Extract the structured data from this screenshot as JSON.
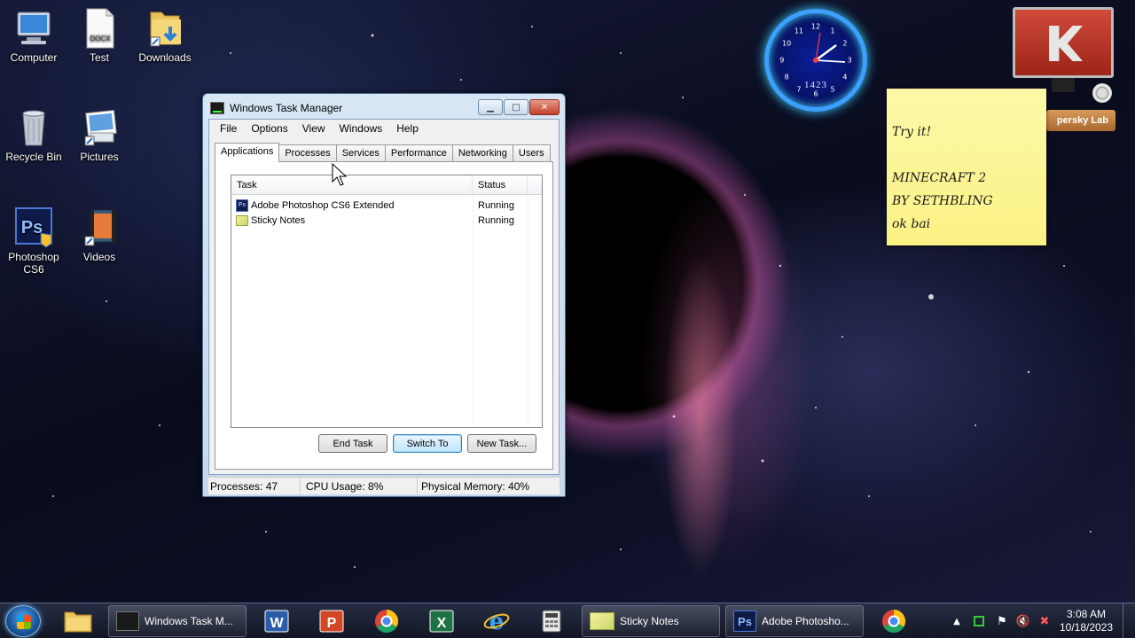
{
  "desktop": {
    "icons": [
      {
        "label": "Computer"
      },
      {
        "label": "Test"
      },
      {
        "label": "Downloads"
      },
      {
        "label": "Recycle Bin"
      },
      {
        "label": "Pictures"
      },
      {
        "label": "Photoshop CS6"
      },
      {
        "label": "Videos"
      }
    ],
    "docx_badge": "DOCX"
  },
  "task_manager": {
    "title": "Windows Task Manager",
    "menu": [
      "File",
      "Options",
      "View",
      "Windows",
      "Help"
    ],
    "tabs": [
      "Applications",
      "Processes",
      "Services",
      "Performance",
      "Networking",
      "Users"
    ],
    "active_tab": "Applications",
    "columns": {
      "task": "Task",
      "status": "Status"
    },
    "rows": [
      {
        "task": "Adobe Photoshop CS6 Extended",
        "status": "Running",
        "icon": "photoshop-icon"
      },
      {
        "task": "Sticky Notes",
        "status": "Running",
        "icon": "sticky-notes-icon"
      }
    ],
    "buttons": {
      "end_task": "End Task",
      "switch_to": "Switch To",
      "new_task": "New Task..."
    },
    "status_bar": {
      "processes": "Processes: 47",
      "cpu": "CPU Usage: 8%",
      "memory": "Physical Memory: 40%"
    }
  },
  "clock_gadget": {
    "digital": "1423",
    "numbers": [
      "12",
      "1",
      "2",
      "3",
      "4",
      "5",
      "6",
      "7",
      "8",
      "9",
      "10",
      "11"
    ]
  },
  "kaspersky_gadget": {
    "label": "persky Lab"
  },
  "sticky_note": {
    "text": "Try it!\n\nMINECRAFT 2\nBY SETHBLING\nok bai"
  },
  "taskbar": {
    "buttons": [
      {
        "label": "Windows Task M..."
      },
      {
        "label": "Sticky Notes"
      },
      {
        "label": "Adobe Photosho..."
      }
    ],
    "time": "3:08 AM",
    "date": "10/18/2023"
  },
  "colors": {
    "accent": "#3c7fb1",
    "sticky": "#fbf285",
    "clock_ring": "#3da0ff"
  }
}
